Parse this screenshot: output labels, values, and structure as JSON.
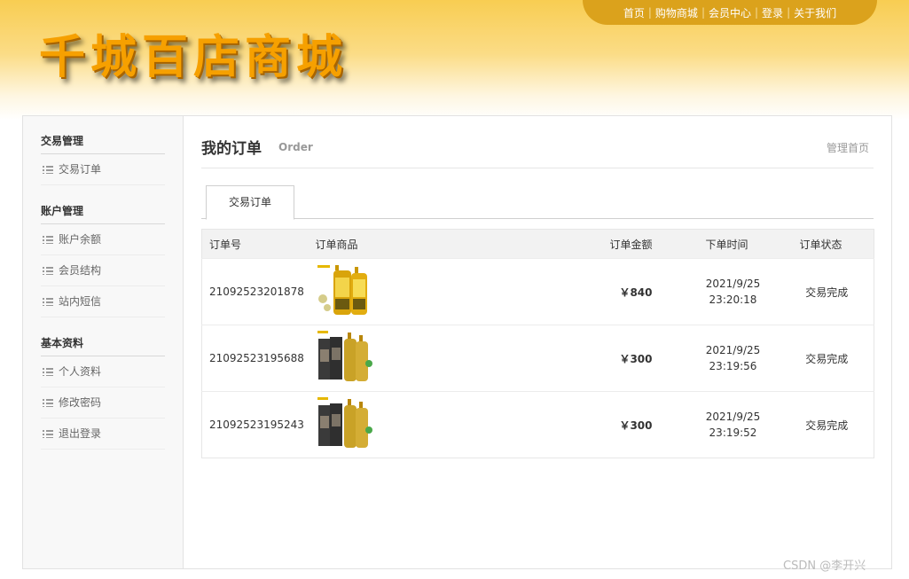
{
  "header": {
    "logo_text": "千城百店商城",
    "nav": [
      "首页",
      "购物商城",
      "会员中心",
      "登录",
      "关于我们"
    ]
  },
  "sidebar": {
    "groups": [
      {
        "title": "交易管理",
        "items": [
          "交易订单"
        ]
      },
      {
        "title": "账户管理",
        "items": [
          "账户余额",
          "会员结构",
          "站内短信"
        ]
      },
      {
        "title": "基本资料",
        "items": [
          "个人资料",
          "修改密码",
          "退出登录"
        ]
      }
    ]
  },
  "main": {
    "title": "我的订单",
    "subtitle": "Order",
    "home_link": "管理首页",
    "tabs": [
      "交易订单"
    ],
    "table": {
      "columns": [
        "订单号",
        "订单商品",
        "订单金额",
        "下单时间",
        "订单状态"
      ],
      "rows": [
        {
          "order_no": "21092523201878",
          "amount": "￥840",
          "date": "2021/9/25",
          "time": "23:20:18",
          "status": "交易完成"
        },
        {
          "order_no": "21092523195688",
          "amount": "￥300",
          "date": "2021/9/25",
          "time": "23:19:56",
          "status": "交易完成"
        },
        {
          "order_no": "21092523195243",
          "amount": "￥300",
          "date": "2021/9/25",
          "time": "23:19:52",
          "status": "交易完成"
        }
      ]
    }
  },
  "watermark": "CSDN @李开兴",
  "colors": {
    "header_gold": "#f8cd52",
    "nav_pill": "#dba21c",
    "logo_orange": "#f6a000",
    "sidebar_bg": "#f8f8f8"
  },
  "icons": {
    "sidebar_item": "list-icon",
    "product": "shampoo-bottles-thumbnail"
  }
}
